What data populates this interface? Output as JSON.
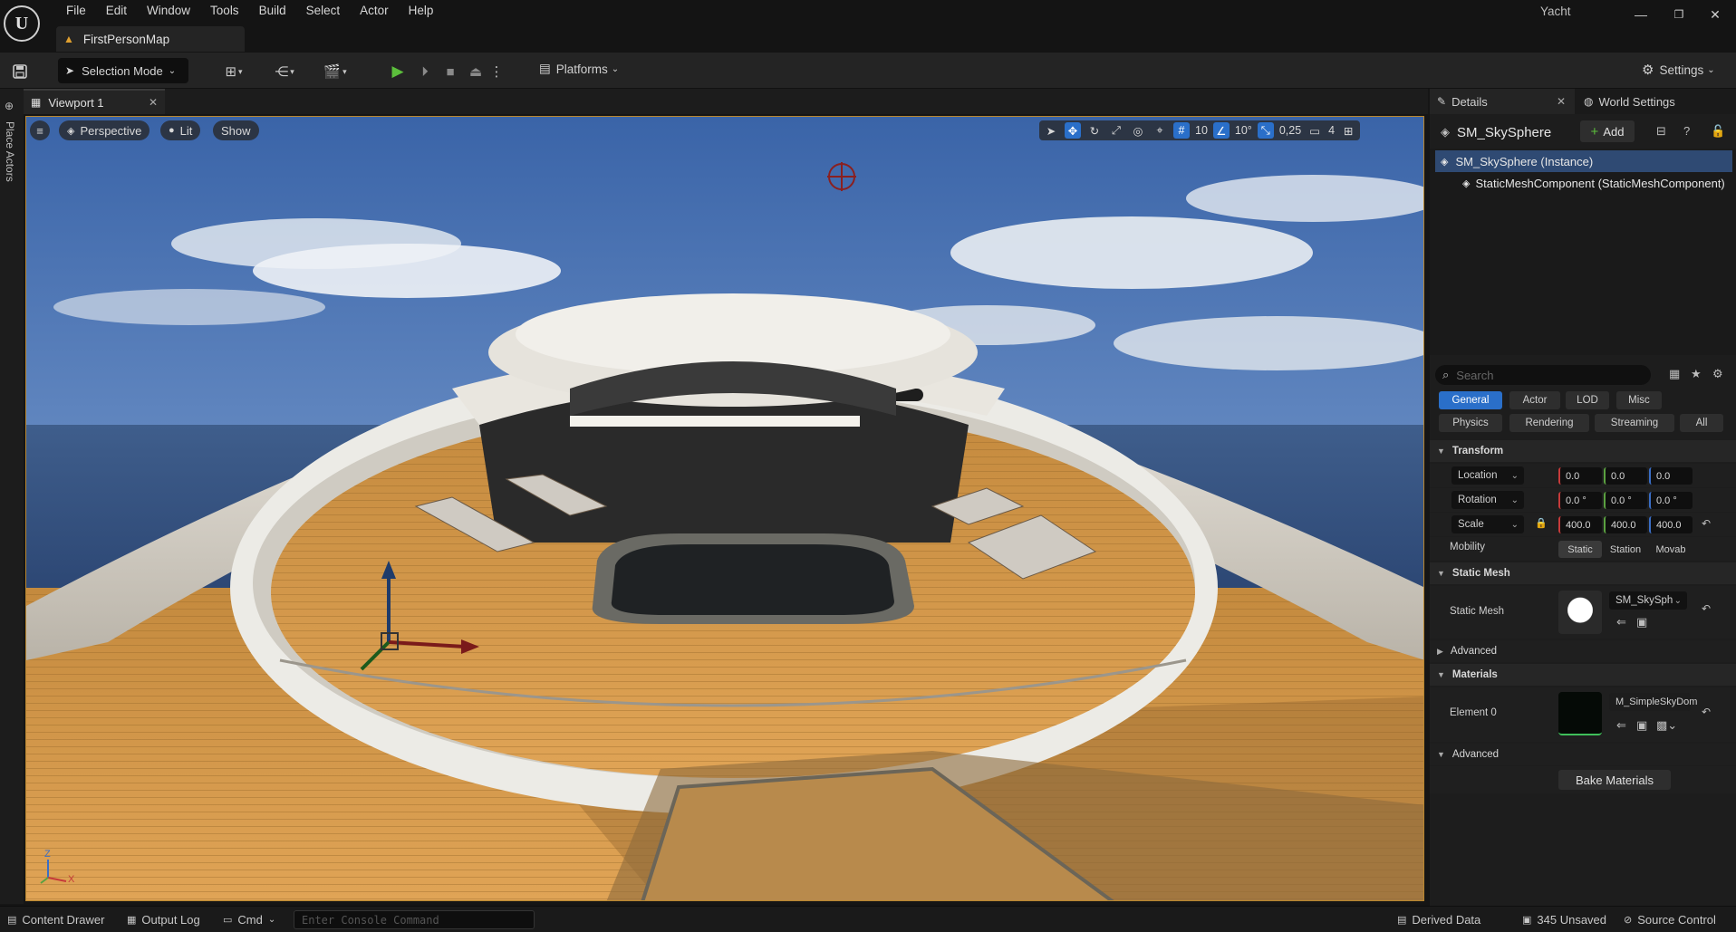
{
  "menubar": {
    "logo": "U",
    "items": [
      "File",
      "Edit",
      "Window",
      "Tools",
      "Build",
      "Select",
      "Actor",
      "Help"
    ],
    "project_name": "Yacht",
    "map_tab": "FirstPersonMap"
  },
  "toolbar": {
    "selection_mode": "Selection Mode",
    "platforms": "Platforms",
    "settings": "Settings"
  },
  "left_strip": {
    "place_actors": "Place Actors"
  },
  "viewport": {
    "tab_label": "Viewport 1",
    "perspective": "Perspective",
    "lit": "Lit",
    "show": "Show",
    "grid_snap": "10",
    "rotation_snap": "10°",
    "scale_snap": "0,25",
    "camera_speed": "4",
    "axis_z": "Z",
    "axis_x": "X"
  },
  "details": {
    "tab_label": "Details",
    "world_settings_label": "World Settings",
    "actor_name": "SM_SkySphere",
    "add_label": "Add",
    "components": [
      {
        "label": "SM_SkySphere (Instance)"
      },
      {
        "label": "StaticMeshComponent (StaticMeshComponent)"
      }
    ],
    "search_placeholder": "Search",
    "filters_row1": [
      "General",
      "Actor",
      "LOD",
      "Misc"
    ],
    "filters_row2": [
      "Physics",
      "Rendering",
      "Streaming",
      "All"
    ],
    "active_filter": "General",
    "transform": {
      "header": "Transform",
      "location": {
        "label": "Location",
        "x": "0.0",
        "y": "0.0",
        "z": "0.0"
      },
      "rotation": {
        "label": "Rotation",
        "x": "0.0 °",
        "y": "0.0 °",
        "z": "0.0 °"
      },
      "scale": {
        "label": "Scale",
        "x": "400.0",
        "y": "400.0",
        "z": "400.0"
      },
      "mobility": {
        "label": "Mobility",
        "options": [
          "Static",
          "Station",
          "Movab"
        ],
        "selected": "Static"
      }
    },
    "static_mesh": {
      "header": "Static Mesh",
      "label": "Static Mesh",
      "value": "SM_SkySph",
      "advanced": "Advanced"
    },
    "materials": {
      "header": "Materials",
      "element_label": "Element 0",
      "element_value": "M_SimpleSkyDom",
      "advanced": "Advanced",
      "bake": "Bake Materials"
    }
  },
  "statusbar": {
    "content_drawer": "Content Drawer",
    "output_log": "Output Log",
    "cmd": "Cmd",
    "console_placeholder": "Enter Console Command",
    "derived_data": "Derived Data",
    "unsaved": "345 Unsaved",
    "source_control": "Source Control"
  },
  "colors": {
    "accent": "#2a6fc9",
    "viewport_border": "#b8862f",
    "selected_row": "#2f4a73"
  }
}
